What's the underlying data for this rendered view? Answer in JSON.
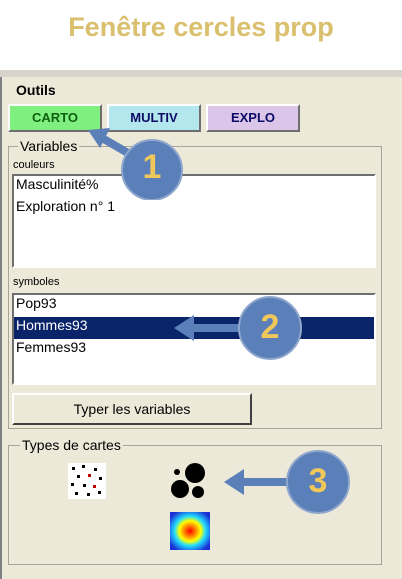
{
  "page_title": "Fenêtre cercles prop",
  "outils": {
    "label": "Outils",
    "tabs": [
      {
        "label": "CARTO",
        "color": "#7ff07f"
      },
      {
        "label": "MULTIV",
        "color": "#b4e6ee"
      },
      {
        "label": "EXPLO",
        "color": "#dbc6ea"
      }
    ]
  },
  "variables": {
    "legend": "Variables",
    "colors_label": "couleurs",
    "colors_items": [
      "Masculinité%",
      "Exploration n° 1"
    ],
    "symbols_label": "symboles",
    "symbols_items": [
      "Pop93",
      "Hommes93",
      "Femmes93"
    ],
    "selected_symbol": "Hommes93",
    "typer_button": "Typer les variables"
  },
  "types_cartes": {
    "legend": "Types de cartes",
    "icons": [
      "dot-density-map-icon",
      "proportional-circles-map-icon",
      "heat-gradient-map-icon"
    ]
  },
  "callouts": [
    {
      "number": "1"
    },
    {
      "number": "2"
    },
    {
      "number": "3"
    }
  ],
  "colors": {
    "title": "#d9bf6e",
    "callout_fill": "#5b7fb8",
    "callout_text": "#f0c85a",
    "selection": "#0a246a"
  }
}
